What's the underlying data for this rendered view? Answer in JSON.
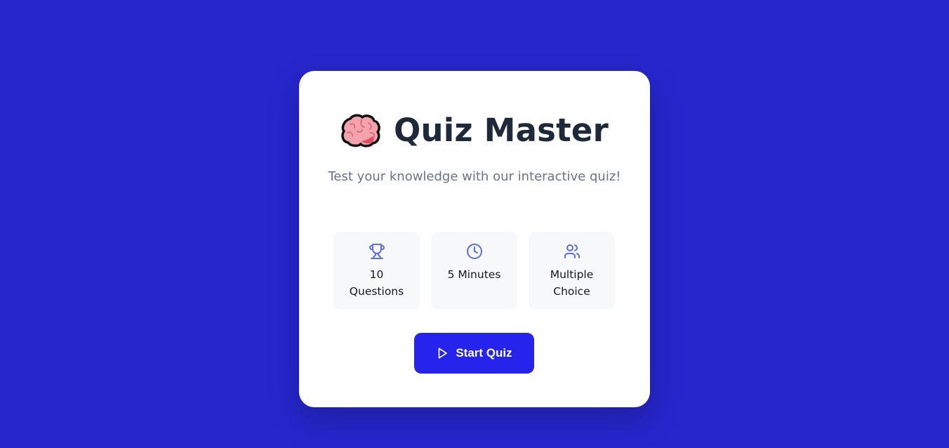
{
  "header": {
    "title": "Quiz Master",
    "subtitle": "Test your knowledge with our interactive quiz!",
    "icon": "brain-icon"
  },
  "features": [
    {
      "icon": "trophy-icon",
      "label": "10 Questions"
    },
    {
      "icon": "clock-icon",
      "label": "5 Minutes"
    },
    {
      "icon": "users-icon",
      "label": "Multiple Choice"
    }
  ],
  "actions": {
    "start_label": "Start Quiz",
    "start_icon": "play-icon"
  },
  "colors": {
    "background": "#2626cc",
    "card": "#ffffff",
    "accent": "#2523ec",
    "icon": "#5b6fe0",
    "title": "#1e2a3a",
    "subtitle": "#6b7280"
  }
}
